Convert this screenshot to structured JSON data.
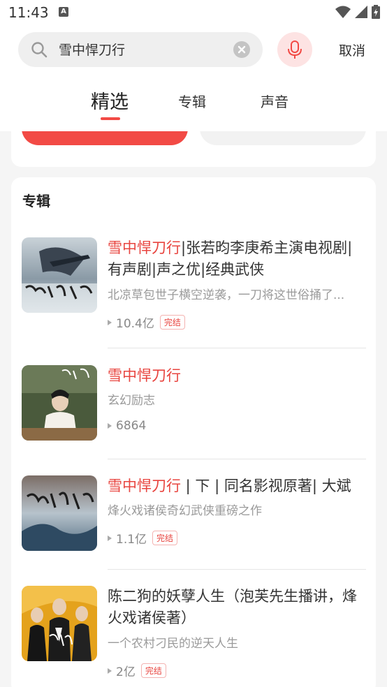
{
  "status": {
    "time": "11:43"
  },
  "search": {
    "query": "雪中悍刀行",
    "cancel_label": "取消"
  },
  "tabs": [
    {
      "label": "精选"
    },
    {
      "label": "专辑"
    },
    {
      "label": "声音"
    }
  ],
  "section": {
    "title": "专辑"
  },
  "albums": [
    {
      "title_highlight": "雪中悍刀行",
      "title_rest": "|张若昀李庚希主演电视剧|有声剧|声之优|经典武侠",
      "desc": "北凉草包世子横空逆袭，一刀将这世俗捅了...",
      "plays": "10.4亿",
      "badge": "完结"
    },
    {
      "title_highlight": "雪中悍刀行",
      "title_rest": "",
      "desc": "玄幻励志",
      "plays": "6864",
      "badge": ""
    },
    {
      "title_highlight": "雪中悍刀行",
      "title_rest": " | 下 | 同名影视原著| 大斌",
      "desc": "烽火戏诸侯奇幻武侠重磅之作",
      "plays": "1.1亿",
      "badge": "完结"
    },
    {
      "title_highlight": "",
      "title_rest": "陈二狗的妖孽人生（泡芙先生播讲，烽火戏诸侯著）",
      "desc": "一个农村刁民的逆天人生",
      "plays": "2亿",
      "badge": "完结"
    }
  ]
}
